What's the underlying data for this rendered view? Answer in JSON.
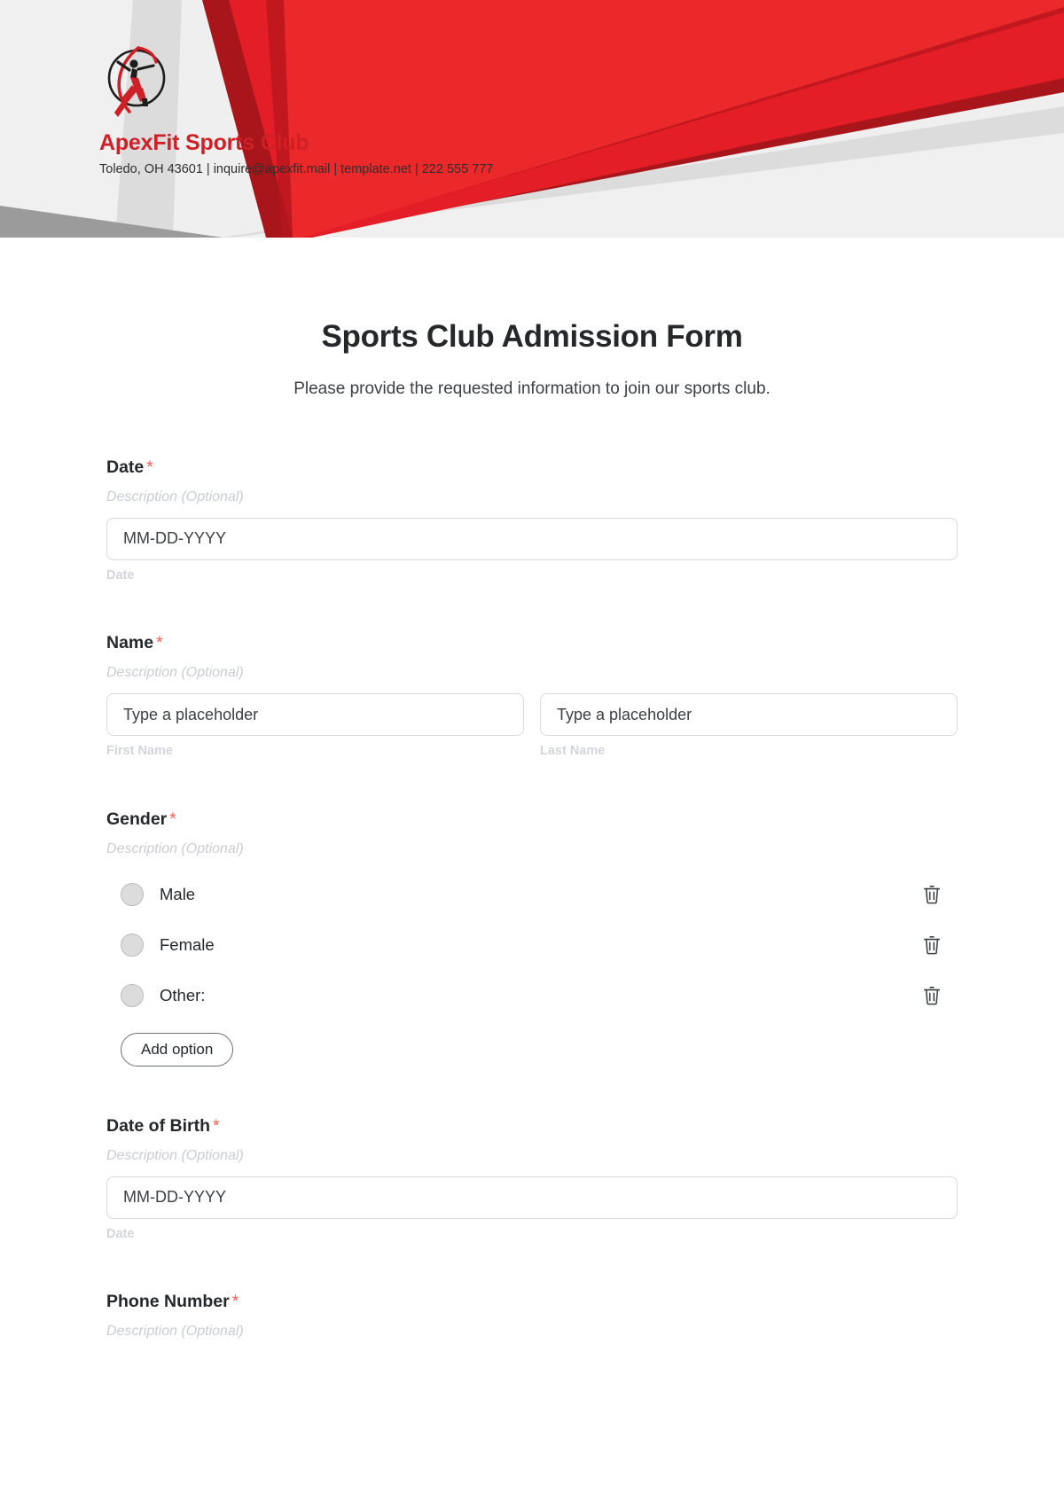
{
  "brand": {
    "name": "ApexFit Sports Club",
    "contact": "Toledo, OH 43601 | inquire@apexfit.mail | template.net | 222 555 777",
    "logo_icon": "running-athlete-in-circle-logo",
    "accent_color": "#cf2027",
    "header_bg": "#f0f0f0",
    "stripe_red": "#e31e26",
    "stripe_dark_red": "#a8151b",
    "stripe_gray": "#d9d9d9",
    "stripe_dark_gray": "#9b9b9b"
  },
  "form": {
    "title": "Sports Club Admission Form",
    "subtitle": "Please provide the requested information to join our sports club.",
    "required_marker": "*",
    "description_placeholder": "Description (Optional)",
    "fields": [
      {
        "label": "Date",
        "description": "Description (Optional)",
        "type": "date",
        "placeholder": "MM-DD-YYYY",
        "sub_label": "Date"
      },
      {
        "label": "Name",
        "description": "Description (Optional)",
        "type": "name",
        "first": {
          "placeholder": "Type a placeholder",
          "sub_label": "First Name"
        },
        "last": {
          "placeholder": "Type a placeholder",
          "sub_label": "Last Name"
        }
      },
      {
        "label": "Gender",
        "description": "Description (Optional)",
        "type": "radio",
        "options": [
          {
            "label": "Male",
            "delete_icon": "trash-icon"
          },
          {
            "label": "Female",
            "delete_icon": "trash-icon"
          },
          {
            "label": "Other:",
            "delete_icon": "trash-icon"
          }
        ],
        "add_option_label": "Add option"
      },
      {
        "label": "Date of Birth",
        "description": "Description (Optional)",
        "type": "date",
        "placeholder": "MM-DD-YYYY",
        "sub_label": "Date"
      },
      {
        "label": "Phone Number",
        "description": "Description (Optional)",
        "type": "text"
      }
    ]
  }
}
